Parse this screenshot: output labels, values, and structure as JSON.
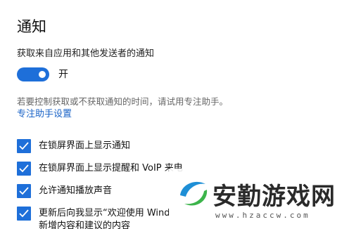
{
  "page": {
    "title": "通知"
  },
  "notifications": {
    "toggle_label": "获取来自应用和其他发送者的通知",
    "toggle_state": "开",
    "toggle_on": true,
    "hint": "若要控制获取或不获取通知的时间，请试用专注助手。",
    "focus_link": "专注助手设置"
  },
  "options": [
    {
      "label": "在锁屏界面上显示通知",
      "checked": true
    },
    {
      "label": "在锁屏界面上显示提醒和 VoIP 来电",
      "checked": true
    },
    {
      "label": "允许通知播放声音",
      "checked": true
    },
    {
      "label": "更新后向我显示“欢迎使用 Wind",
      "label_line2": "新增内容和建议的内容",
      "checked": true
    }
  ],
  "watermark": {
    "text": "安勤游戏网",
    "url": "www.hzaccw.com"
  },
  "colors": {
    "accent": "#1e6fd9",
    "link": "#1a63c7",
    "hint": "#666666"
  }
}
